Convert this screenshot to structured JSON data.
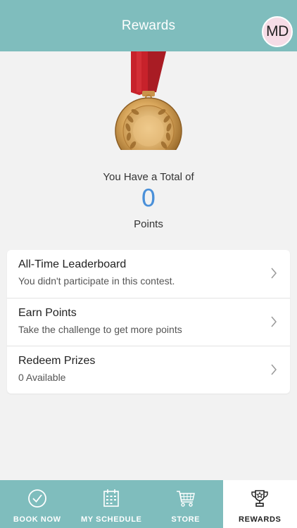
{
  "header": {
    "title": "Rewards",
    "avatar_initials": "MD"
  },
  "summary": {
    "total_label": "You Have a Total of",
    "points": "0",
    "points_unit": "Points"
  },
  "menu": {
    "items": [
      {
        "title": "All-Time Leaderboard",
        "subtitle": "You didn't participate in this contest."
      },
      {
        "title": "Earn Points",
        "subtitle": "Take the challenge to get more points"
      },
      {
        "title": "Redeem Prizes",
        "subtitle": "0 Available"
      }
    ]
  },
  "tabbar": {
    "items": [
      {
        "label": "BOOK NOW",
        "icon": "check-circle-icon"
      },
      {
        "label": "MY SCHEDULE",
        "icon": "calendar-icon"
      },
      {
        "label": "STORE",
        "icon": "cart-icon"
      },
      {
        "label": "REWARDS",
        "icon": "trophy-icon",
        "active": true
      }
    ]
  },
  "colors": {
    "header_bg": "#7fbdbd",
    "avatar_bg": "#f6dce6",
    "points_blue": "#4a90d9",
    "tab_active_bg": "#ffffff"
  }
}
